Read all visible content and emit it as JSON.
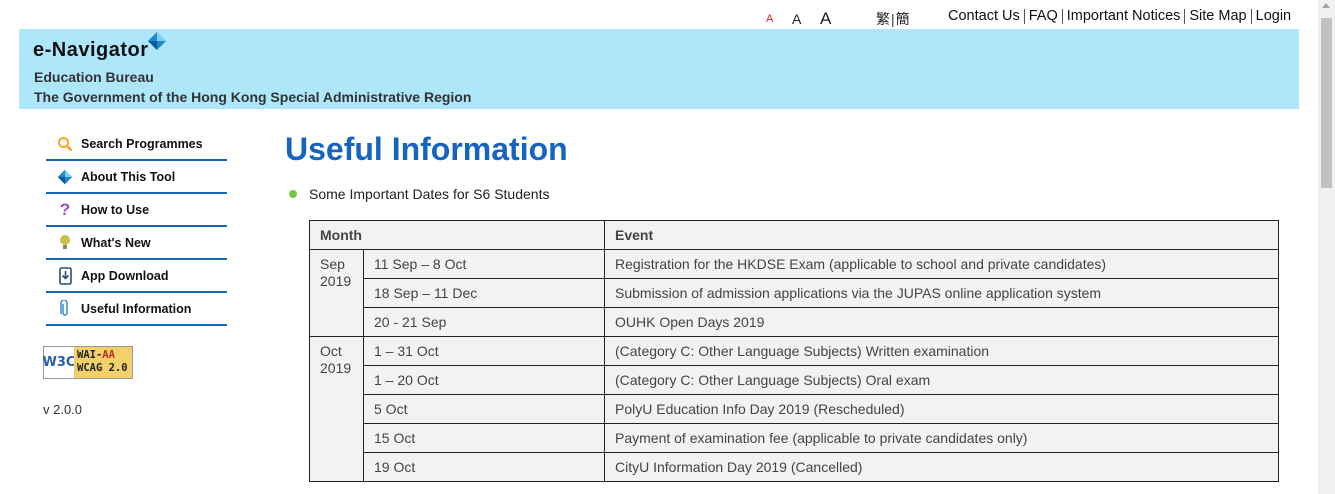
{
  "font_size": {
    "small": "A",
    "medium": "A",
    "large": "A"
  },
  "language": {
    "traditional": "繁",
    "simplified": "簡"
  },
  "top_links": [
    "Contact Us",
    "FAQ",
    "Important Notices",
    "Site Map",
    "Login"
  ],
  "header": {
    "logo": "e-Navigator",
    "bureau": "Education Bureau",
    "government": "The Government of the Hong Kong Special Administrative Region"
  },
  "sidebar": {
    "items": [
      {
        "label": "Search Programmes",
        "icon": "search-icon"
      },
      {
        "label": "About This Tool",
        "icon": "compass-icon"
      },
      {
        "label": "How to Use",
        "icon": "question-icon"
      },
      {
        "label": "What's New",
        "icon": "lightbulb-icon"
      },
      {
        "label": "App Download",
        "icon": "download-icon"
      },
      {
        "label": "Useful Information",
        "icon": "paperclip-icon"
      }
    ],
    "badge": {
      "w3c": "W3C",
      "line1_a": "WAI-",
      "line1_b": "AA",
      "line2": "WCAG 2.0"
    },
    "version": "v 2.0.0"
  },
  "main": {
    "title": "Useful Information",
    "subtitle": "Some Important Dates for S6 Students",
    "table": {
      "headers": [
        "Month",
        "Event"
      ],
      "groups": [
        {
          "month": "Sep",
          "year": "2019",
          "rows": [
            {
              "date": "11 Sep – 8 Oct",
              "event": "Registration for the HKDSE Exam (applicable to school and private candidates)"
            },
            {
              "date": "18 Sep – 11 Dec",
              "event": "Submission of admission applications via the JUPAS online application system"
            },
            {
              "date": "20 - 21 Sep",
              "event": "OUHK Open Days 2019"
            }
          ]
        },
        {
          "month": "Oct",
          "year": "2019",
          "rows": [
            {
              "date": "1 – 31 Oct",
              "event": "(Category C: Other Language Subjects) Written examination"
            },
            {
              "date": "1 – 20 Oct",
              "event": "(Category C: Other Language Subjects) Oral exam"
            },
            {
              "date": "5 Oct",
              "event": "PolyU Education Info Day 2019 (Rescheduled)"
            },
            {
              "date": "15 Oct",
              "event": "Payment of examination fee (applicable to private candidates only)"
            },
            {
              "date": "19 Oct",
              "event": "CityU Information Day 2019 (Cancelled)"
            }
          ]
        }
      ]
    }
  },
  "colors": {
    "banner": "#aee6fa",
    "title": "#1565c0",
    "nav_border": "#1a64b5",
    "bullet": "#7cc142"
  }
}
